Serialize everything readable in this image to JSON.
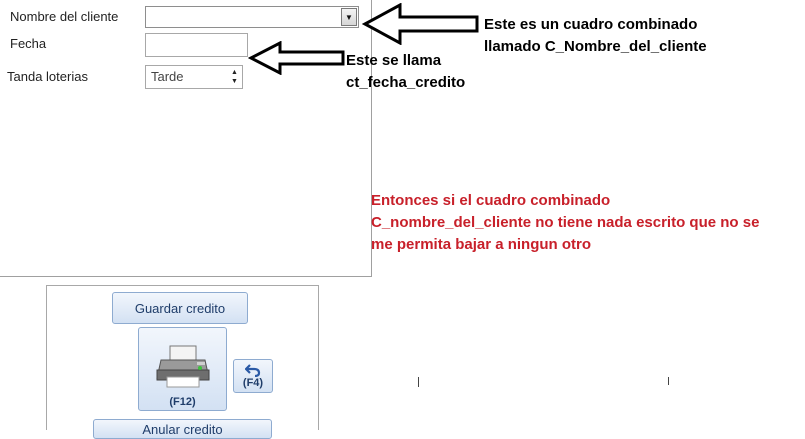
{
  "form": {
    "client_label": "Nombre del cliente",
    "client_value": "",
    "date_label": "Fecha",
    "date_value": "",
    "tanda_label": "Tanda loterias",
    "tanda_value": "Tarde"
  },
  "annotations": {
    "combo_note_line1": "Este es un cuadro combinado",
    "combo_note_line2": "llamado C_Nombre_del_cliente",
    "date_note_line1": "Este se llama",
    "date_note_line2": "ct_fecha_credito",
    "question_line1": "Entonces si el cuadro combinado",
    "question_line2": "C_nombre_del_cliente no tiene nada escrito que no se",
    "question_line3": "me permita bajar a ningun otro",
    "question_color": "#c8202a"
  },
  "buttons": {
    "save_label": "Guardar credito",
    "print_caption": "(F12)",
    "undo_caption": "(F4)",
    "bottom_label": "Anular credito"
  },
  "icons": {
    "print": "printer-icon",
    "undo": "undo-arrow-icon",
    "dropdown": "chevron-down-icon",
    "spin_up": "spin-up-icon",
    "spin_down": "spin-down-icon"
  }
}
